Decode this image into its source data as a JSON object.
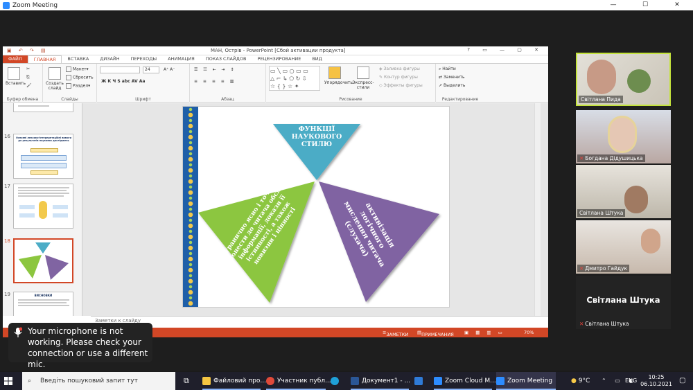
{
  "zoom": {
    "window_title": "Zoom Meeting",
    "controls": {
      "minimize": "—",
      "maximize": "☐",
      "close": "✕"
    }
  },
  "ppt": {
    "title": "МАН, Острів - PowerPoint [Сбой активации продукта]",
    "title_controls": "? ▭ — ▢ ✕",
    "tabs": [
      "ФАЙЛ",
      "ГЛАВНАЯ",
      "ВСТАВКА",
      "ДИЗАЙН",
      "ПЕРЕХОДЫ",
      "АНИМАЦИЯ",
      "ПОКАЗ СЛАЙДОВ",
      "РЕЦЕНЗИРОВАНИЕ",
      "ВИД"
    ],
    "ribbon": {
      "paste": "Вставить",
      "cut_icon": "scissors-icon",
      "clipboard_label": "Буфер обмена",
      "new_slide": "Создать слайд",
      "layout": "Макет",
      "reset": "Сбросить",
      "section": "Раздел",
      "slides_label": "Слайды",
      "font_size": "24",
      "font_buttons": "Ж  К  Ч  S  abc  AV  Aa",
      "font_label": "Шрифт",
      "paragraph_label": "Абзац",
      "arrange": "Упорядочить",
      "quick_styles": "Экспресс-стили",
      "shape_fill": "Заливка фигуры",
      "shape_outline": "Контур фигуры",
      "shape_effects": "Эффекты фигуры",
      "drawing_label": "Рисование",
      "find": "Найти",
      "replace": "Заменить",
      "select": "Выделить",
      "editing_label": "Редактирование"
    },
    "thumbnails": [
      {
        "num": "16",
        "title": "Основні лексико-інтерпретаційні вимоги до результатів наукових досліджень"
      },
      {
        "num": "17",
        "title": ""
      },
      {
        "num": "18",
        "title": ""
      },
      {
        "num": "19",
        "title": "ВИСНОВКИ"
      }
    ],
    "slide": {
      "top_triangle": "ФУНКЦІЇ НАУКОВОГО СТИЛЮ",
      "left_triangle": "гранично ясно і точно донести до читача обсяг інформації, докази її істинності, а також новизни і цінності",
      "right_triangle": "активізація логічного мислення читача (слухача)",
      "colors": {
        "top": "#4bacc6",
        "left": "#8cc63f",
        "right": "#8064a2"
      }
    },
    "notes_placeholder": "Заметки к слайду",
    "status": {
      "notes": "ЗАМЕТКИ",
      "comments": "ПРИМЕЧАНИЯ",
      "zoom": "70%"
    }
  },
  "participants": [
    {
      "name": "Світлана Пида",
      "active": true
    },
    {
      "name": "Богдана Дідушицька",
      "muted": true
    },
    {
      "name": "Світлана Штука"
    },
    {
      "name": "Дмитро Гайдук",
      "muted": true
    },
    {
      "name": "Світлана Штука",
      "muted": true,
      "avatar_text": "Світлана Штука"
    }
  ],
  "toast": {
    "message": "Your microphone is not working. Please check your connection or use a different mic."
  },
  "taskbar": {
    "search_placeholder": "Введіть пошуковий запит тут",
    "apps": [
      "Файловий про...",
      "Участник публ...",
      "Документ1 - ...",
      "Zoom Cloud M...",
      "Zoom Meeting"
    ],
    "weather": "9°C",
    "lang": "ENG",
    "time": "10:25",
    "date": "06.10.2021"
  }
}
